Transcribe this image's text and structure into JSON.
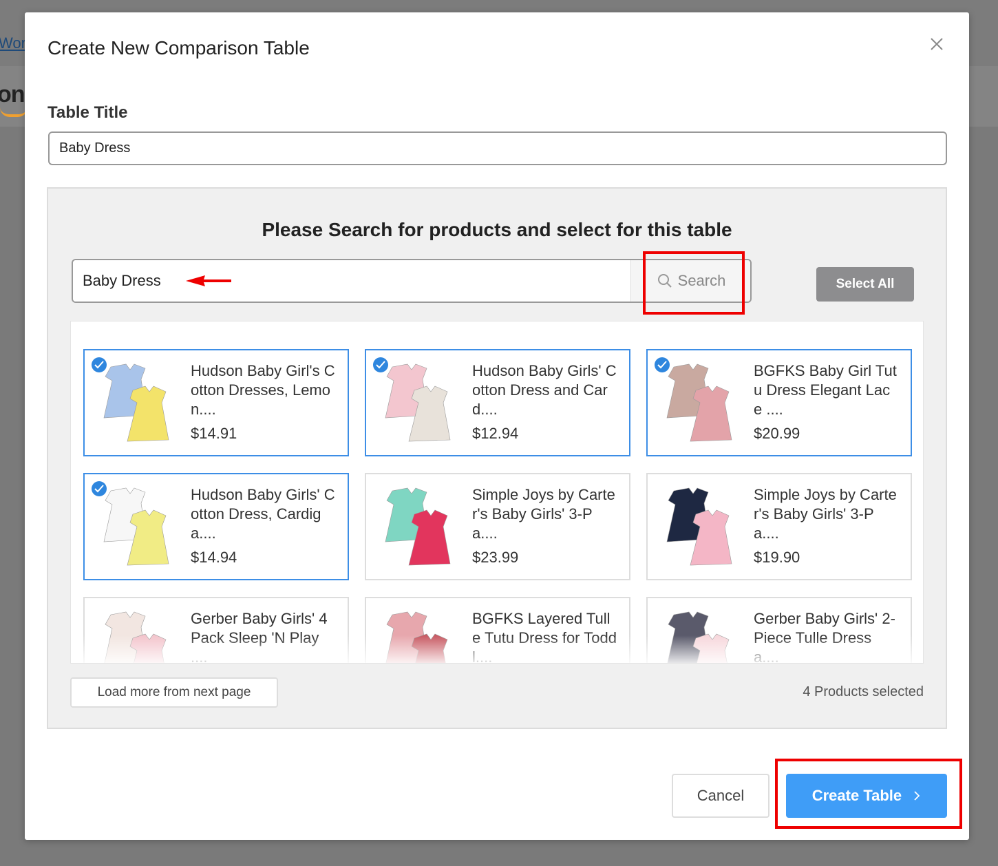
{
  "background": {
    "link_text": "Word",
    "logo_text": "on"
  },
  "modal": {
    "title": "Create New Comparison Table",
    "close_icon": "close-icon",
    "table_title_label": "Table Title",
    "table_title_value": "Baby Dress"
  },
  "search": {
    "heading": "Please Search for products and select for this table",
    "query": "Baby Dress",
    "button_label": "Search",
    "select_all_label": "Select All"
  },
  "products": [
    {
      "name": "Hudson Baby Girl's Cotton Dresses, Lemon....",
      "price": "$14.91",
      "selected": true
    },
    {
      "name": "Hudson Baby Girls' Cotton Dress and Card....",
      "price": "$12.94",
      "selected": true
    },
    {
      "name": "BGFKS Baby Girl Tutu Dress Elegant Lace ....",
      "price": "$20.99",
      "selected": true
    },
    {
      "name": "Hudson Baby Girls' Cotton Dress, Cardiga....",
      "price": "$14.94",
      "selected": true
    },
    {
      "name": "Simple Joys by Carter's Baby Girls' 3-Pa....",
      "price": "$23.99",
      "selected": false
    },
    {
      "name": "Simple Joys by Carter's Baby Girls' 3-Pa....",
      "price": "$19.90",
      "selected": false
    },
    {
      "name": "Gerber Baby Girls' 4 Pack Sleep 'N Play ....",
      "price": "",
      "selected": false
    },
    {
      "name": "BGFKS Layered Tulle Tutu Dress for Toddl....",
      "price": "",
      "selected": false
    },
    {
      "name": "Gerber Baby Girls' 2-Piece Tulle Dress a....",
      "price": "",
      "selected": false
    }
  ],
  "footer": {
    "load_more_label": "Load more from next page",
    "selected_count": "4 Products selected",
    "cancel_label": "Cancel",
    "create_label": "Create Table",
    "create_icon": "chevron-right-icon"
  },
  "colors": {
    "accent": "#3f9df7",
    "selected_border": "#3d8ee6",
    "highlight": "#e00000",
    "select_all_bg": "#8d8d8f"
  }
}
